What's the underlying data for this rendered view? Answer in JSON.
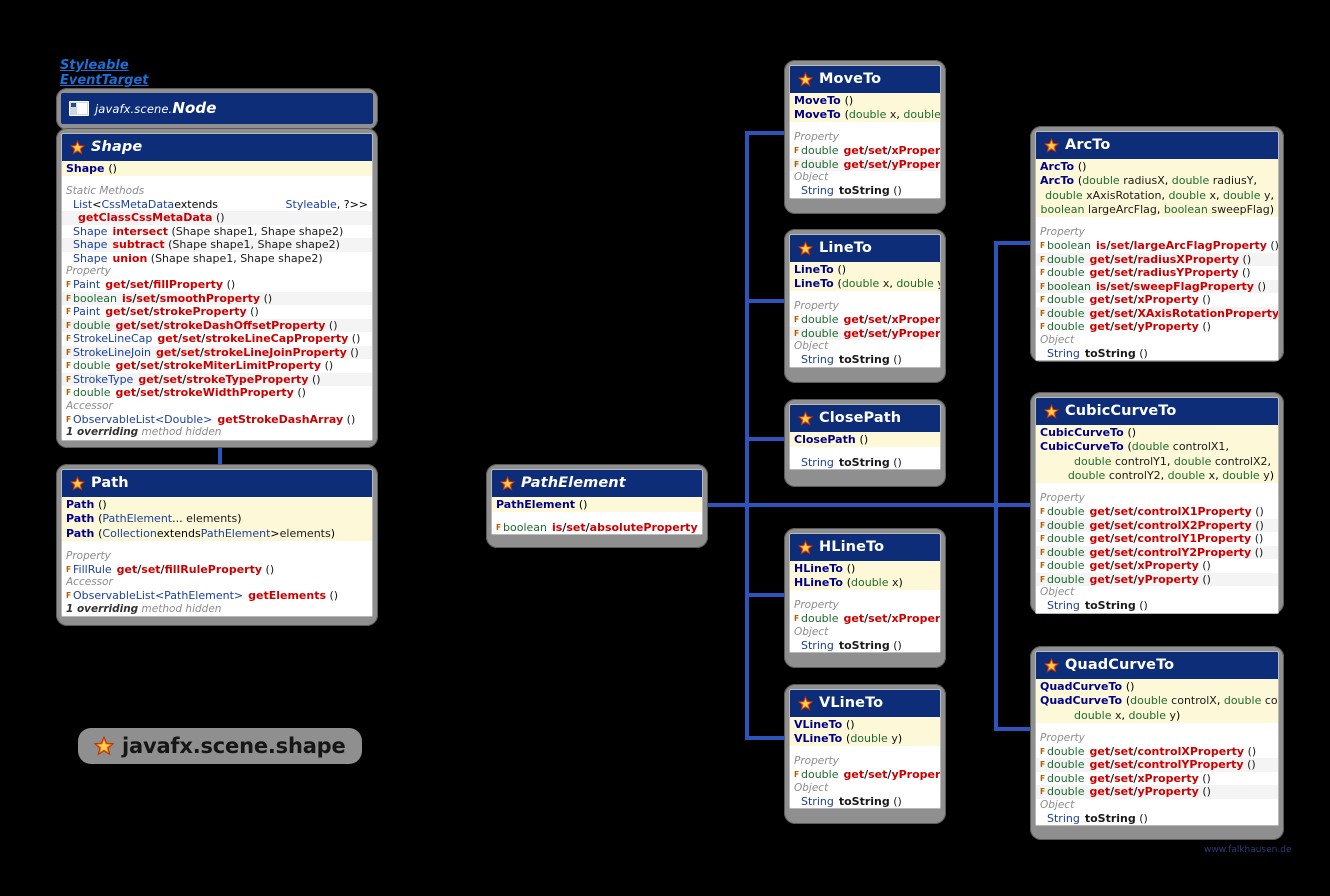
{
  "meta": {
    "package_label": "javafx.scene.shape",
    "watermark": "www.falkhausen.de",
    "supertypes": [
      "Styleable",
      "EventTarget"
    ],
    "accent": "#0d2d79",
    "connector_color": "#2b55bb",
    "ctor_bg": "#fdf8d8"
  },
  "classes": {
    "node": {
      "package": "javafx.scene.",
      "name": "Node",
      "icon": "node-icon"
    },
    "shape": {
      "name": "Shape",
      "icon": "star-icon",
      "ctors": [
        {
          "name": "Shape",
          "args": "()"
        }
      ],
      "sections": [
        {
          "label": "Static Methods",
          "rows": [
            {
              "type": "List<CssMetaData<? extends Styleable, ?>>",
              "name": "",
              "args": "",
              "fullwidth": true
            },
            {
              "type": "",
              "name": "getClassCssMetaData",
              "args": "()"
            },
            {
              "type": "Shape",
              "name": "intersect",
              "args": "(Shape shape1, Shape shape2)"
            },
            {
              "type": "Shape",
              "name": "subtract",
              "args": "(Shape shape1, Shape shape2)"
            },
            {
              "type": "Shape",
              "name": "union",
              "args": "(Shape shape1, Shape shape2)"
            }
          ]
        },
        {
          "label": "Property",
          "rows": [
            {
              "f": "F",
              "type": "Paint",
              "name": "get/set/fillProperty",
              "args": "()"
            },
            {
              "f": "F",
              "type": "boolean",
              "name": "is/set/smoothProperty",
              "args": "()"
            },
            {
              "f": "F",
              "type": "Paint",
              "name": "get/set/strokeProperty",
              "args": "()"
            },
            {
              "f": "F",
              "type": "double",
              "name": "get/set/strokeDashOffsetProperty",
              "args": "()"
            },
            {
              "f": "F",
              "type": "StrokeLineCap",
              "name": "get/set/strokeLineCapProperty",
              "args": "()"
            },
            {
              "f": "F",
              "type": "StrokeLineJoin",
              "name": "get/set/strokeLineJoinProperty",
              "args": "()"
            },
            {
              "f": "F",
              "type": "double",
              "name": "get/set/strokeMiterLimitProperty",
              "args": "()"
            },
            {
              "f": "F",
              "type": "StrokeType",
              "name": "get/set/strokeTypeProperty",
              "args": "()"
            },
            {
              "f": "F",
              "type": "double",
              "name": "get/set/strokeWidthProperty",
              "args": "()"
            }
          ]
        },
        {
          "label": "Accessor",
          "rows": [
            {
              "f": "F",
              "type": "ObservableList<Double>",
              "name": "getStrokeDashArray",
              "args": "()"
            }
          ]
        }
      ],
      "footer": "1 overriding method hidden"
    },
    "path": {
      "name": "Path",
      "icon": "star-icon",
      "ctors": [
        {
          "name": "Path",
          "args": "()"
        },
        {
          "name": "Path",
          "args": "(PathElement... elements)"
        },
        {
          "name": "Path",
          "args": "(Collection<? extends PathElement> elements)"
        }
      ],
      "sections": [
        {
          "label": "Property",
          "rows": [
            {
              "f": "F",
              "type": "FillRule",
              "name": "get/set/fillRuleProperty",
              "args": "()"
            }
          ]
        },
        {
          "label": "Accessor",
          "rows": [
            {
              "f": "F",
              "type": "ObservableList<PathElement>",
              "name": "getElements",
              "args": "()"
            }
          ]
        }
      ],
      "footer": "1 overriding method hidden"
    },
    "pathelement": {
      "name": "PathElement",
      "icon": "star-icon",
      "ctors": [
        {
          "name": "PathElement",
          "args": "()"
        }
      ],
      "sections": [
        {
          "label": "",
          "rows": [
            {
              "f": "F",
              "type": "boolean",
              "name": "is/set/absoluteProperty",
              "args": "()"
            }
          ]
        }
      ]
    },
    "moveto": {
      "name": "MoveTo",
      "icon": "star-icon",
      "ctors": [
        {
          "name": "MoveTo",
          "args": "()"
        },
        {
          "name": "MoveTo",
          "args": "(double x, double y)"
        }
      ],
      "sections": [
        {
          "label": "Property",
          "rows": [
            {
              "f": "F",
              "type": "double",
              "name": "get/set/xProperty",
              "args": "()"
            },
            {
              "f": "F",
              "type": "double",
              "name": "get/set/yProperty",
              "args": "()"
            }
          ]
        },
        {
          "label": "Object",
          "rows": [
            {
              "type": "String",
              "name": "toString",
              "args": "()",
              "plain": true
            }
          ]
        }
      ]
    },
    "lineto": {
      "name": "LineTo",
      "icon": "star-icon",
      "ctors": [
        {
          "name": "LineTo",
          "args": "()"
        },
        {
          "name": "LineTo",
          "args": "(double x, double y)"
        }
      ],
      "sections": [
        {
          "label": "Property",
          "rows": [
            {
              "f": "F",
              "type": "double",
              "name": "get/set/xProperty",
              "args": "()"
            },
            {
              "f": "F",
              "type": "double",
              "name": "get/set/yProperty",
              "args": "()"
            }
          ]
        },
        {
          "label": "Object",
          "rows": [
            {
              "type": "String",
              "name": "toString",
              "args": "()",
              "plain": true
            }
          ]
        }
      ]
    },
    "closepath": {
      "name": "ClosePath",
      "icon": "star-icon",
      "ctors": [
        {
          "name": "ClosePath",
          "args": "()"
        }
      ],
      "sections": [
        {
          "label": "",
          "rows": [
            {
              "type": "String",
              "name": "toString",
              "args": "()",
              "plain": true
            }
          ]
        }
      ]
    },
    "hlineto": {
      "name": "HLineTo",
      "icon": "star-icon",
      "ctors": [
        {
          "name": "HLineTo",
          "args": "()"
        },
        {
          "name": "HLineTo",
          "args": "(double x)"
        }
      ],
      "sections": [
        {
          "label": "Property",
          "rows": [
            {
              "f": "F",
              "type": "double",
              "name": "get/set/xProperty",
              "args": "()"
            }
          ]
        },
        {
          "label": "Object",
          "rows": [
            {
              "type": "String",
              "name": "toString",
              "args": "()",
              "plain": true
            }
          ]
        }
      ]
    },
    "vlineto": {
      "name": "VLineTo",
      "icon": "star-icon",
      "ctors": [
        {
          "name": "VLineTo",
          "args": "()"
        },
        {
          "name": "VLineTo",
          "args": "(double y)"
        }
      ],
      "sections": [
        {
          "label": "Property",
          "rows": [
            {
              "f": "F",
              "type": "double",
              "name": "get/set/yProperty",
              "args": "()"
            }
          ]
        },
        {
          "label": "Object",
          "rows": [
            {
              "type": "String",
              "name": "toString",
              "args": "()",
              "plain": true
            }
          ]
        }
      ]
    },
    "arcto": {
      "name": "ArcTo",
      "icon": "star-icon",
      "ctors": [
        {
          "name": "ArcTo",
          "args": "()"
        },
        {
          "name": "ArcTo",
          "args": "(double radiusX, double radiusY,"
        },
        {
          "name": "",
          "args": "double xAxisRotation, double x, double y,"
        },
        {
          "name": "",
          "args": "boolean largeArcFlag, boolean sweepFlag)"
        }
      ],
      "sections": [
        {
          "label": "Property",
          "rows": [
            {
              "f": "F",
              "type": "boolean",
              "name": "is/set/largeArcFlagProperty",
              "args": "()"
            },
            {
              "f": "F",
              "type": "double",
              "name": "get/set/radiusXProperty",
              "args": "()"
            },
            {
              "f": "F",
              "type": "double",
              "name": "get/set/radiusYProperty",
              "args": "()"
            },
            {
              "f": "F",
              "type": "boolean",
              "name": "is/set/sweepFlagProperty",
              "args": "()"
            },
            {
              "f": "F",
              "type": "double",
              "name": "get/set/xProperty",
              "args": "()"
            },
            {
              "f": "F",
              "type": "double",
              "name": "get/set/XAxisRotationProperty",
              "args": "()"
            },
            {
              "f": "F",
              "type": "double",
              "name": "get/set/yProperty",
              "args": "()"
            }
          ]
        },
        {
          "label": "Object",
          "rows": [
            {
              "type": "String",
              "name": "toString",
              "args": "()",
              "plain": true
            }
          ]
        }
      ]
    },
    "cubiccurveto": {
      "name": "CubicCurveTo",
      "icon": "star-icon",
      "ctors": [
        {
          "name": "CubicCurveTo",
          "args": "()"
        },
        {
          "name": "CubicCurveTo",
          "args": "(double controlX1,"
        },
        {
          "name": "",
          "args": "double controlY1, double controlX2,"
        },
        {
          "name": "",
          "args": "double controlY2, double x, double y)"
        }
      ],
      "sections": [
        {
          "label": "Property",
          "rows": [
            {
              "f": "F",
              "type": "double",
              "name": "get/set/controlX1Property",
              "args": "()"
            },
            {
              "f": "F",
              "type": "double",
              "name": "get/set/controlX2Property",
              "args": "()"
            },
            {
              "f": "F",
              "type": "double",
              "name": "get/set/controlY1Property",
              "args": "()"
            },
            {
              "f": "F",
              "type": "double",
              "name": "get/set/controlY2Property",
              "args": "()"
            },
            {
              "f": "F",
              "type": "double",
              "name": "get/set/xProperty",
              "args": "()"
            },
            {
              "f": "F",
              "type": "double",
              "name": "get/set/yProperty",
              "args": "()"
            }
          ]
        },
        {
          "label": "Object",
          "rows": [
            {
              "type": "String",
              "name": "toString",
              "args": "()",
              "plain": true
            }
          ]
        }
      ]
    },
    "quadcurveto": {
      "name": "QuadCurveTo",
      "icon": "star-icon",
      "ctors": [
        {
          "name": "QuadCurveTo",
          "args": "()"
        },
        {
          "name": "QuadCurveTo",
          "args": "(double controlX, double controlY,"
        },
        {
          "name": "",
          "args": "double x, double y)"
        }
      ],
      "sections": [
        {
          "label": "Property",
          "rows": [
            {
              "f": "F",
              "type": "double",
              "name": "get/set/controlXProperty",
              "args": "()"
            },
            {
              "f": "F",
              "type": "double",
              "name": "get/set/controlYProperty",
              "args": "()"
            },
            {
              "f": "F",
              "type": "double",
              "name": "get/set/xProperty",
              "args": "()"
            },
            {
              "f": "F",
              "type": "double",
              "name": "get/set/yProperty",
              "args": "()"
            }
          ]
        },
        {
          "label": "Object",
          "rows": [
            {
              "type": "String",
              "name": "toString",
              "args": "()",
              "plain": true
            }
          ]
        }
      ]
    }
  }
}
